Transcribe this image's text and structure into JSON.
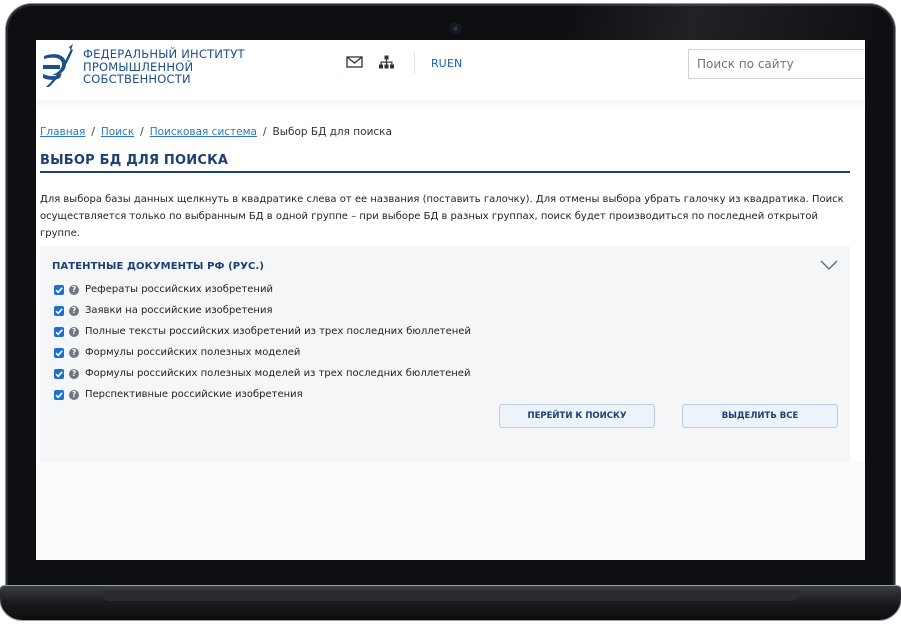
{
  "header": {
    "logo_lines": [
      "ФЕДЕРАЛЬНЫЙ ИНСТИТУТ",
      "ПРОМЫШЛЕННОЙ",
      "СОБСТВЕННОСТИ"
    ],
    "lang_ru": "RU",
    "lang_en": "EN",
    "search_placeholder": "Поиск по сайту",
    "icons": [
      "mail-icon",
      "sitemap-icon"
    ]
  },
  "breadcrumb": {
    "items": [
      "Главная",
      "Поиск",
      "Поисковая система"
    ],
    "current": "Выбор БД для поиска",
    "separator": "/"
  },
  "page": {
    "title": "ВЫБОР БД ДЛЯ ПОИСКА",
    "description": "Для выбора базы данных щелкнуть в квадратике слева от ее названия (поставить галочку). Для отмены выбора убрать галочку из квадратика. Поиск осуществляется только по выбранным БД в одной группе – при выборе БД в разных группах, поиск будет производиться по последней открытой группе."
  },
  "group": {
    "title": "ПАТЕНТНЫЕ ДОКУМЕНТЫ РФ (РУС.)",
    "help_glyph": "?",
    "databases": [
      {
        "label": "Рефераты российских изобретений",
        "checked": true
      },
      {
        "label": "Заявки на российские изобретения",
        "checked": true
      },
      {
        "label": "Полные тексты российских изобретений из трех последних бюллетеней",
        "checked": true
      },
      {
        "label": "Формулы российских полезных моделей",
        "checked": true
      },
      {
        "label": "Формулы российских полезных моделей из трех последних бюллетеней",
        "checked": true
      },
      {
        "label": "Перспективные российские изобретения",
        "checked": true
      }
    ],
    "go_to_search_label": "ПЕРЕЙТИ К ПОИСКУ",
    "select_all_label": "ВЫДЕЛИТЬ ВСЕ"
  },
  "colors": {
    "brand": "#1c4f8c",
    "title": "#1c3f74",
    "link": "#2b78c5",
    "checkbox": "#1e6fd0"
  }
}
